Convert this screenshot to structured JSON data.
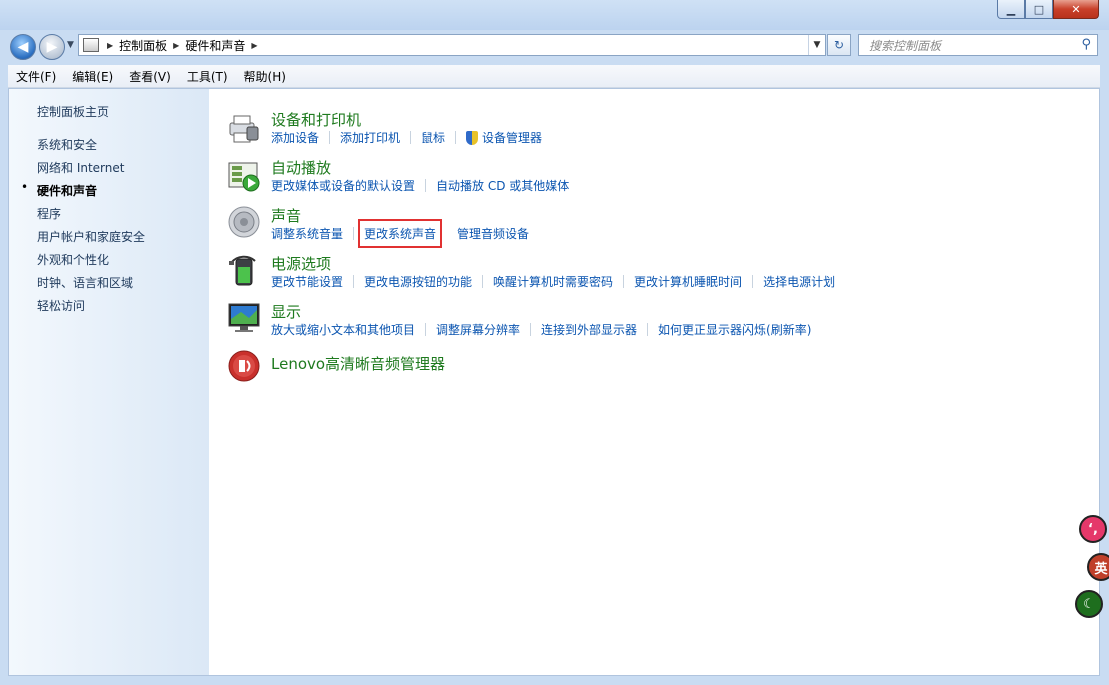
{
  "window": {
    "controls": [
      "minimize",
      "maximize",
      "close"
    ]
  },
  "address": {
    "crumbs": [
      "控制面板",
      "硬件和声音"
    ]
  },
  "search": {
    "placeholder": "搜索控制面板"
  },
  "menubar": {
    "items": [
      "文件(F)",
      "编辑(E)",
      "查看(V)",
      "工具(T)",
      "帮助(H)"
    ]
  },
  "sidebar": {
    "home": "控制面板主页",
    "items": [
      "系统和安全",
      "网络和 Internet",
      "硬件和声音",
      "程序",
      "用户帐户和家庭安全",
      "外观和个性化",
      "时钟、语言和区域",
      "轻松访问"
    ],
    "active_index": 2
  },
  "categories": [
    {
      "title": "设备和打印机",
      "icon": "printer-icon",
      "links": [
        "添加设备",
        "添加打印机",
        "鼠标",
        "设备管理器"
      ]
    },
    {
      "title": "自动播放",
      "icon": "autoplay-icon",
      "links": [
        "更改媒体或设备的默认设置",
        "自动播放 CD 或其他媒体"
      ]
    },
    {
      "title": "声音",
      "icon": "speaker-icon",
      "links": [
        "调整系统音量",
        "更改系统声音",
        "管理音频设备"
      ],
      "highlighted_link": 1
    },
    {
      "title": "电源选项",
      "icon": "battery-icon",
      "links": [
        "更改节能设置",
        "更改电源按钮的功能",
        "唤醒计算机时需要密码",
        "更改计算机睡眠时间",
        "选择电源计划"
      ]
    },
    {
      "title": "显示",
      "icon": "monitor-icon",
      "links": [
        "放大或缩小文本和其他项目",
        "调整屏幕分辨率",
        "连接到外部显示器",
        "如何更正显示器闪烁(刷新率)"
      ]
    },
    {
      "title": "Lenovo高清晰音频管理器",
      "icon": "lenovo-audio-icon",
      "links": []
    }
  ],
  "floating_tools": {
    "ime_label": "英"
  },
  "colors": {
    "link": "#0b55b0",
    "category_title": "#1e7a1e",
    "highlight": "#e13131"
  }
}
